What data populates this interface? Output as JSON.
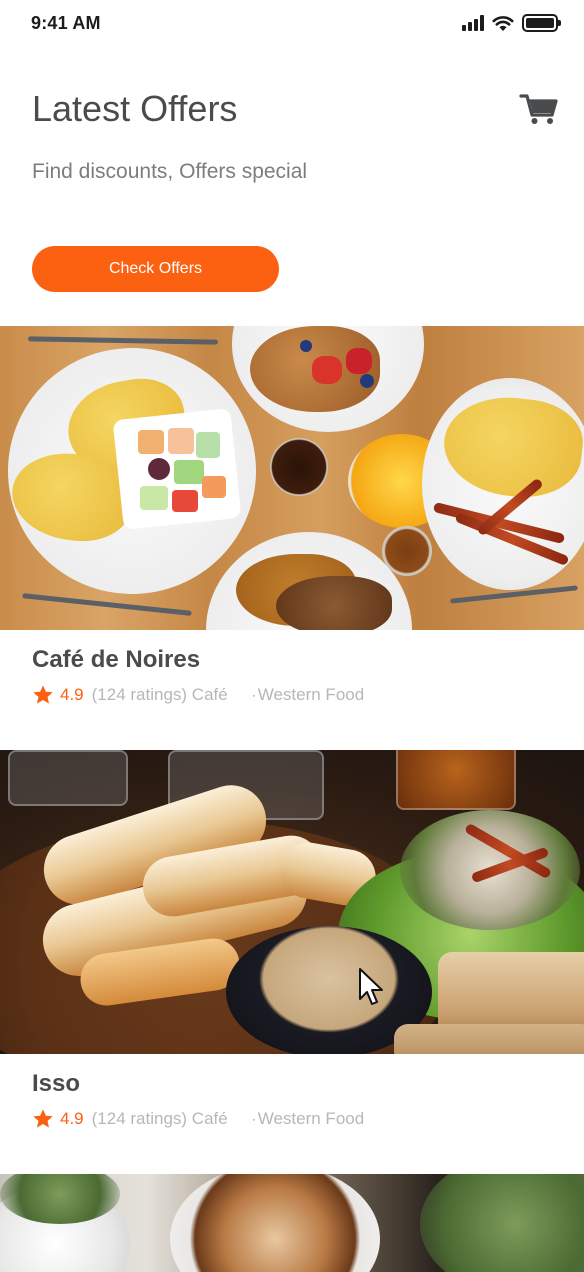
{
  "status_bar": {
    "time": "9:41 AM"
  },
  "header": {
    "title": "Latest Offers",
    "subtitle": "Find discounts, Offers special",
    "cta_label": "Check Offers"
  },
  "restaurants": [
    {
      "name": "Café de Noires",
      "rating": "4.9",
      "ratings_count": "(124 ratings) Café",
      "cuisine": "Western Food"
    },
    {
      "name": "Isso",
      "rating": "4.9",
      "ratings_count": "(124 ratings) Café",
      "cuisine": "Western Food"
    }
  ],
  "icons": {
    "cart": "cart-icon",
    "star": "star-icon",
    "signal": "signal-icon",
    "wifi": "wifi-icon",
    "battery": "battery-icon"
  },
  "colors": {
    "accent": "#fc6011",
    "title": "#4a4b4d",
    "secondary_text": "#7c7d7e",
    "meta_text": "#b6b7b7"
  }
}
